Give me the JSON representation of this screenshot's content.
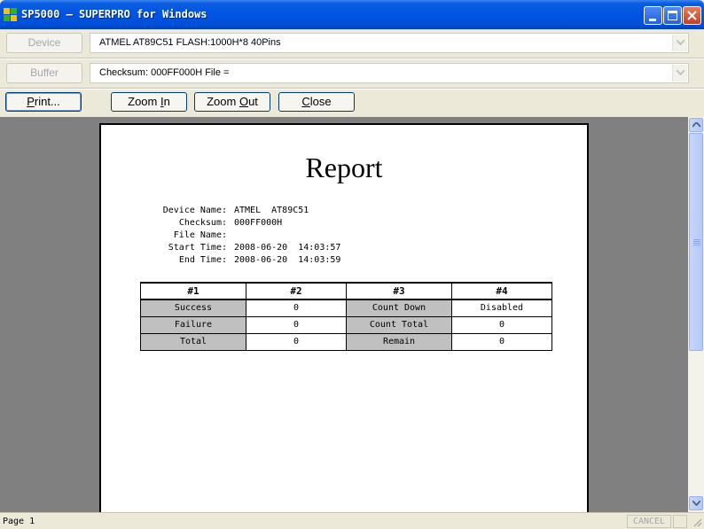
{
  "window": {
    "title": "SP5000 — SUPERPRO for Windows",
    "controls": [
      "minimize-icon",
      "maximize-icon",
      "close-icon"
    ]
  },
  "device_row": {
    "button_label": "Device",
    "value": "ATMEL  AT89C51  FLASH:1000H*8  40Pins"
  },
  "buffer_row": {
    "button_label": "Buffer",
    "value": "Checksum: 000FF000H    File ="
  },
  "toolbar": {
    "print_prefix": "P",
    "print_rest": "rint...",
    "zoom_in_a": "Zoom ",
    "zoom_in_u": "I",
    "zoom_in_b": "n",
    "zoom_out_a": "Zoom ",
    "zoom_out_u": "O",
    "zoom_out_b": "ut",
    "close_u": "C",
    "close_rest": "lose"
  },
  "report": {
    "title": "Report",
    "info": [
      {
        "label": "Device Name:",
        "value": "ATMEL  AT89C51"
      },
      {
        "label": "Checksum:",
        "value": "000FF000H"
      },
      {
        "label": "File Name:",
        "value": ""
      },
      {
        "label": "Start Time:",
        "value": "2008-06-20  14:03:57"
      },
      {
        "label": "End Time:",
        "value": "2008-06-20  14:03:59"
      }
    ],
    "table": {
      "headers": [
        "#1",
        "#2",
        "#3",
        "#4"
      ],
      "rows": [
        [
          "Success",
          "0",
          "Count Down",
          "Disabled"
        ],
        [
          "Failure",
          "0",
          "Count Total",
          "0"
        ],
        [
          "Total",
          "0",
          "Remain",
          "0"
        ]
      ]
    }
  },
  "status": {
    "page": "Page 1",
    "cancel": "CANCEL"
  },
  "colors": {
    "title_bar": "#0054e3",
    "preview_bg": "#808080",
    "window_bg": "#ece9d8",
    "label_cell": "#c0c0c0"
  }
}
